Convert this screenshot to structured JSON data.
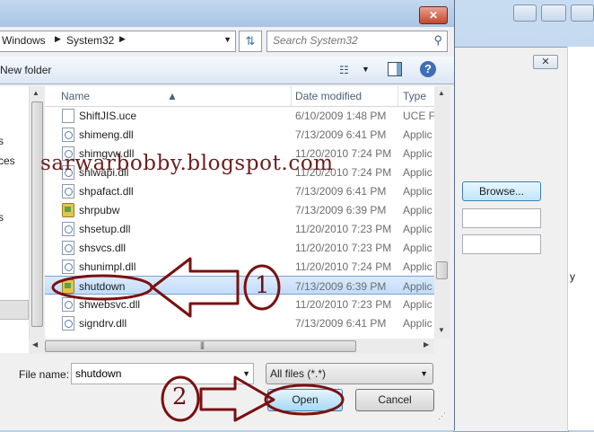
{
  "dialog": {
    "close_glyph": "✕",
    "breadcrumb": [
      "Windows",
      "System32"
    ],
    "search_placeholder": "Search System32",
    "new_folder": "New folder",
    "help_glyph": "?"
  },
  "columns": {
    "name": "Name",
    "date": "Date modified",
    "type": "Type"
  },
  "files": [
    {
      "name": "ShiftJIS.uce",
      "date": "6/10/2009 1:48 PM",
      "type": "UCE Fi",
      "icon": "file-icon"
    },
    {
      "name": "shimeng.dll",
      "date": "7/13/2009 6:41 PM",
      "type": "Applic",
      "icon": "dll-icon"
    },
    {
      "name": "shimgvw.dll",
      "date": "11/20/2010 7:24 PM",
      "type": "Applic",
      "icon": "dll-icon"
    },
    {
      "name": "shlwapi.dll",
      "date": "11/20/2010 7:24 PM",
      "type": "Applic",
      "icon": "dll-icon"
    },
    {
      "name": "shpafact.dll",
      "date": "7/13/2009 6:41 PM",
      "type": "Applic",
      "icon": "dll-icon"
    },
    {
      "name": "shrpubw",
      "date": "7/13/2009 6:39 PM",
      "type": "Applic",
      "icon": "exe-icon"
    },
    {
      "name": "shsetup.dll",
      "date": "11/20/2010 7:23 PM",
      "type": "Applic",
      "icon": "dll-icon"
    },
    {
      "name": "shsvcs.dll",
      "date": "11/20/2010 7:23 PM",
      "type": "Applic",
      "icon": "dll-icon"
    },
    {
      "name": "shunimpl.dll",
      "date": "11/20/2010 7:24 PM",
      "type": "Applic",
      "icon": "dll-icon"
    },
    {
      "name": "shutdown",
      "date": "7/13/2009 6:39 PM",
      "type": "Applic",
      "icon": "exe-icon",
      "selected": true
    },
    {
      "name": "shwebsvc.dll",
      "date": "11/20/2010 7:23 PM",
      "type": "Applic",
      "icon": "dll-icon"
    },
    {
      "name": "signdrv.dll",
      "date": "7/13/2009 6:41 PM",
      "type": "Applic",
      "icon": "dll-icon"
    }
  ],
  "nav_fragments": [
    "s",
    "ces",
    "s"
  ],
  "bottom": {
    "file_name_label": "File name:",
    "file_name_value": "shutdown",
    "file_type": "All files (*.*)",
    "open_label": "Open",
    "cancel_label": "Cancel"
  },
  "background_window": {
    "browse_label": "Browse...",
    "close_glyph": "✕",
    "fragment": "y"
  },
  "overlay": {
    "watermark": "sarwarbobby.blogspot.com",
    "step1": "1",
    "step2": "2",
    "annotation_color": "#7a1010"
  }
}
